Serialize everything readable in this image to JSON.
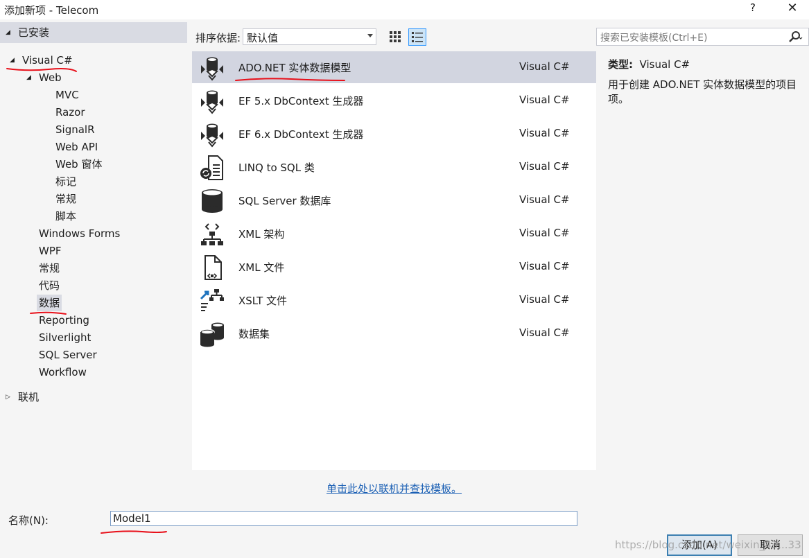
{
  "window": {
    "title": "添加新项 - Telecom",
    "help_label": "?",
    "close_label": "✕"
  },
  "sidebar": {
    "installed_label": "已安装",
    "visual_csharp": "Visual C#",
    "web": "Web",
    "web_children": [
      "MVC",
      "Razor",
      "SignalR",
      "Web API",
      "Web 窗体",
      "标记",
      "常规",
      "脚本"
    ],
    "categories": [
      "Windows Forms",
      "WPF",
      "常规",
      "代码",
      "数据",
      "Reporting",
      "Silverlight",
      "SQL Server",
      "Workflow"
    ],
    "selected_category": "数据",
    "online_label": "联机"
  },
  "toolbar": {
    "sort_label": "排序依据:",
    "sort_value": "默认值",
    "search_placeholder": "搜索已安装模板(Ctrl+E)"
  },
  "templates": [
    {
      "name": "ADO.NET 实体数据模型",
      "type": "Visual C#",
      "icon": "ado-entity-icon",
      "selected": true
    },
    {
      "name": "EF 5.x DbContext 生成器",
      "type": "Visual C#",
      "icon": "ef-generator-icon"
    },
    {
      "name": "EF 6.x DbContext 生成器",
      "type": "Visual C#",
      "icon": "ef-generator-icon"
    },
    {
      "name": "LINQ to SQL 类",
      "type": "Visual C#",
      "icon": "linq-to-sql-icon"
    },
    {
      "name": "SQL Server 数据库",
      "type": "Visual C#",
      "icon": "database-icon"
    },
    {
      "name": "XML 架构",
      "type": "Visual C#",
      "icon": "xml-schema-icon"
    },
    {
      "name": "XML 文件",
      "type": "Visual C#",
      "icon": "xml-file-icon"
    },
    {
      "name": "XSLT 文件",
      "type": "Visual C#",
      "icon": "xslt-file-icon"
    },
    {
      "name": "数据集",
      "type": "Visual C#",
      "icon": "dataset-icon"
    }
  ],
  "detail": {
    "type_label": "类型:",
    "type_value": "Visual C#",
    "description": "用于创建 ADO.NET 实体数据模型的项目项。"
  },
  "online_link": "单击此处以联机并查找模板。",
  "footer": {
    "name_label": "名称(N):",
    "name_value": "Model1",
    "add_button": "添加(A)",
    "cancel_button": "取消"
  },
  "watermark": "https://blog.csdn.net/weixin_43...33",
  "colors": {
    "selection": "#d2d5e0",
    "link": "#1a5fb4",
    "annotation": "#e8101a"
  }
}
